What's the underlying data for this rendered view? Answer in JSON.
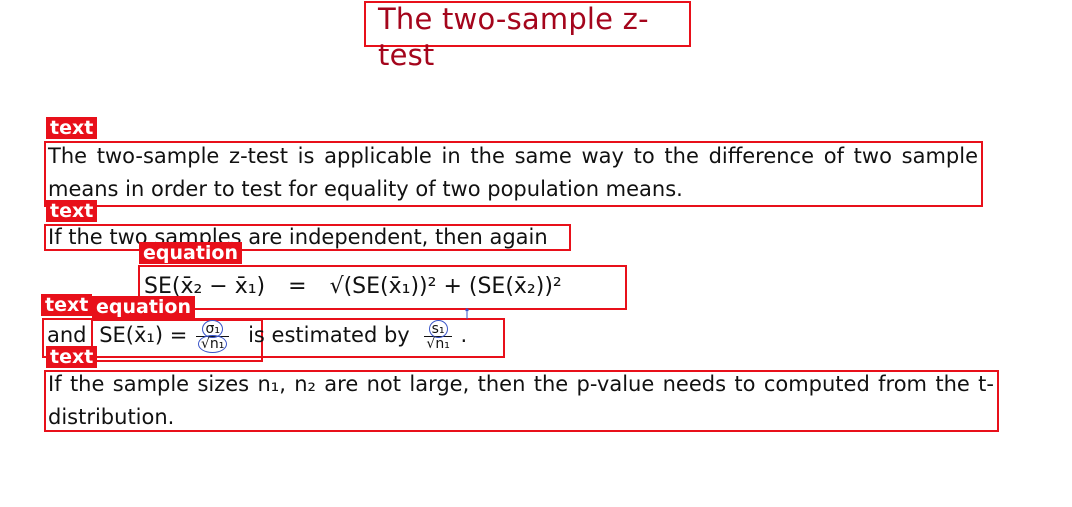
{
  "slide_title": "The two-sample z-test",
  "region_tags": {
    "text": "text",
    "equation": "equation"
  },
  "paragraph_1": "The two-sample z-test is applicable in the same way to the difference of two sample means in order to test for equality of two population means.",
  "paragraph_2": "If the two samples are independent, then again",
  "equation_1": {
    "lhs": "SE(x̄₂ − x̄₁)",
    "equals": "=",
    "rhs": "√(SE(x̄₁))² + (SE(x̄₂))²"
  },
  "line_4": {
    "and_word": "and",
    "se_expr": "SE(x̄₁) =",
    "frac1_num": "σ₁",
    "frac1_den": "√n₁",
    "middle_text": "is estimated by",
    "frac2_num": "s₁",
    "frac2_den": "√n₁",
    "end_punct": "."
  },
  "paragraph_5": "If the sample sizes n₁, n₂ are not large, then the p-value needs to computed from the t-distribution.",
  "colors": {
    "annotation_red": "#e8101a",
    "title_red": "#a4051c",
    "pen_blue": "#3a55c8"
  }
}
